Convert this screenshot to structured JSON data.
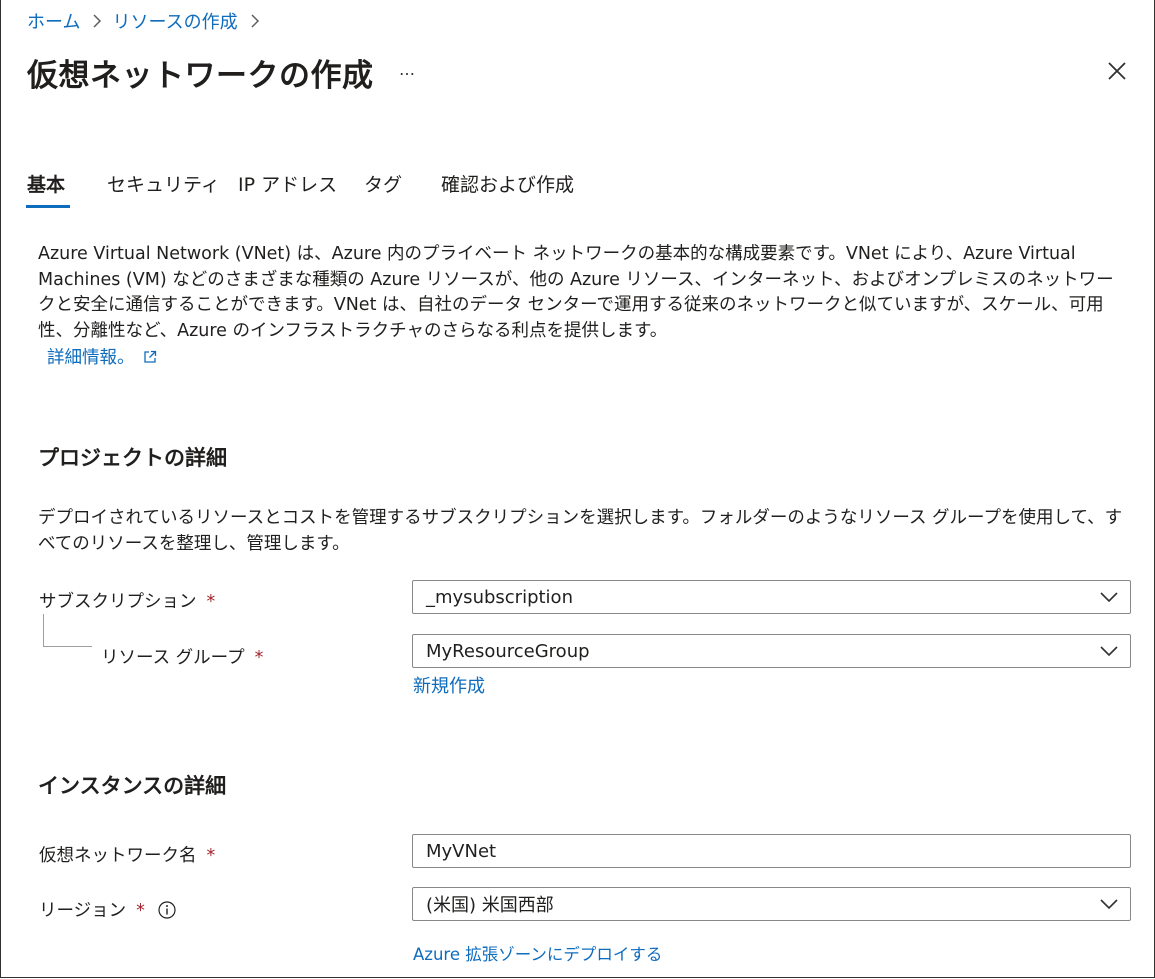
{
  "breadcrumb": {
    "items": [
      "ホーム",
      "リソースの作成"
    ]
  },
  "header": {
    "title": "仮想ネットワークの作成",
    "more": "…"
  },
  "tabs": [
    {
      "label": "基本",
      "active": true
    },
    {
      "label": "セキュリティ",
      "active": false
    },
    {
      "label": "IP アドレス",
      "active": false
    },
    {
      "label": "タグ",
      "active": false
    },
    {
      "label": "確認および作成",
      "active": false
    }
  ],
  "intro": {
    "description": "Azure Virtual Network (VNet) は、Azure 内のプライベート ネットワークの基本的な構成要素です。VNet により、Azure Virtual Machines (VM) などのさまざまな種類の Azure リソースが、他の Azure リソース、インターネット、およびオンプレミスのネットワークと安全に通信することができます。VNet は、自社のデータ センターで運用する従来のネットワークと似ていますが、スケール、可用性、分離性など、Azure のインフラストラクチャのさらなる利点を提供します。",
    "learn_more": "詳細情報。"
  },
  "project": {
    "title": "プロジェクトの詳細",
    "description": "デプロイされているリソースとコストを管理するサブスクリプションを選択します。フォルダーのようなリソース グループを使用して、すべてのリソースを整理し、管理します。",
    "subscription_label": "サブスクリプション",
    "subscription_value": "_mysubscription",
    "resource_group_label": "リソース グループ",
    "resource_group_value": "MyResourceGroup",
    "create_new": "新規作成"
  },
  "instance": {
    "title": "インスタンスの詳細",
    "vnet_name_label": "仮想ネットワーク名",
    "vnet_name_value": "MyVNet",
    "region_label": "リージョン",
    "region_value": "(米国) 米国西部",
    "edge_zone_link": "Azure 拡張ゾーンにデプロイする"
  },
  "required_marker": "*",
  "colors": {
    "accent": "#0f6cbd",
    "required": "#a4262c",
    "text": "#201f1e",
    "border": "#8a8886"
  },
  "icons": [
    "chevron-right-icon",
    "close-icon",
    "external-link-icon",
    "chevron-down-icon",
    "info-icon"
  ]
}
